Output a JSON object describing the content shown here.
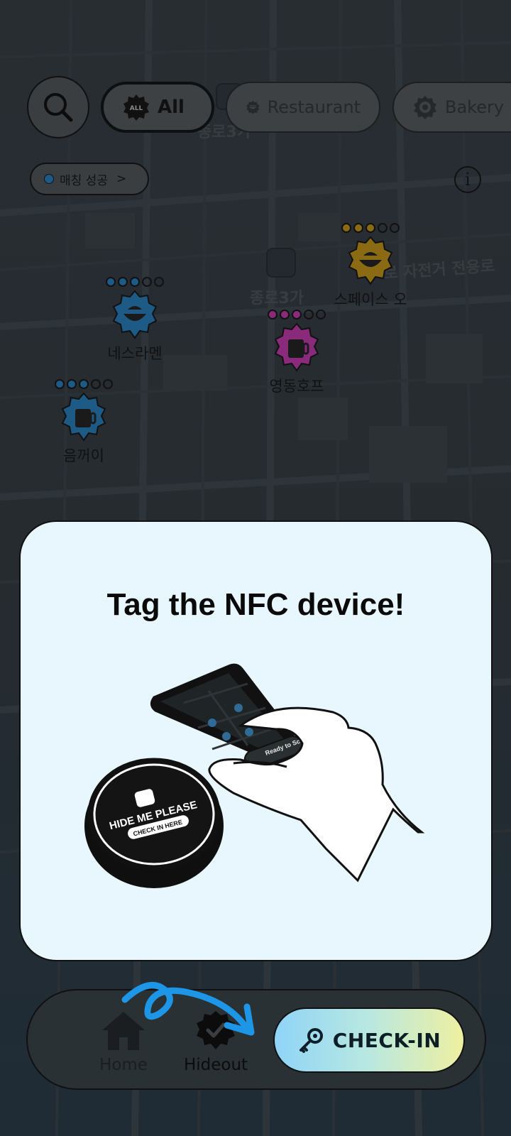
{
  "filters": {
    "search_icon": "search-icon",
    "chips": [
      {
        "label": "All",
        "badge": "ALL",
        "icon": "all-badge-icon",
        "active": true
      },
      {
        "label": "Restaurant",
        "icon": "bowl-icon",
        "active": false
      },
      {
        "label": "Bakery",
        "icon": "bakery-icon",
        "active": false
      }
    ]
  },
  "match_chip": {
    "label": "매칭 성공",
    "chevron": ">"
  },
  "info_button": {
    "label": "i"
  },
  "map": {
    "labels": [
      "종로3가",
      "종로3가",
      "로 자전거 전용로"
    ],
    "markers": [
      {
        "name": "네스라멘",
        "category": "restaurant",
        "color": "#1d5a86",
        "rating_filled": 3,
        "rating_total": 5
      },
      {
        "name": "영동호프",
        "category": "pub",
        "color": "#8a2a7a",
        "rating_filled": 3,
        "rating_total": 5
      },
      {
        "name": "스페이스 오",
        "category": "restaurant",
        "color": "#8a6a12",
        "rating_filled": 3,
        "rating_total": 5
      },
      {
        "name": "음꺼이",
        "category": "pub",
        "color": "#1d5a86",
        "rating_filled": 3,
        "rating_total": 5
      }
    ]
  },
  "modal": {
    "title": "Tag the NFC device!",
    "nfc_tag_brand": "HIDE ME PLEASE",
    "nfc_tag_subtitle": "CHECK IN HERE",
    "phone_status": "Ready to Scan"
  },
  "bottom_nav": {
    "home_label": "Home",
    "hideout_label": "Hideout",
    "checkin_label": "CHECK-IN"
  },
  "colors": {
    "modal_bg": "#e8f7fd",
    "checkin_gradient_start": "#8fd4f8",
    "checkin_gradient_end": "#eef0a0",
    "arrow": "#1e96e8"
  }
}
